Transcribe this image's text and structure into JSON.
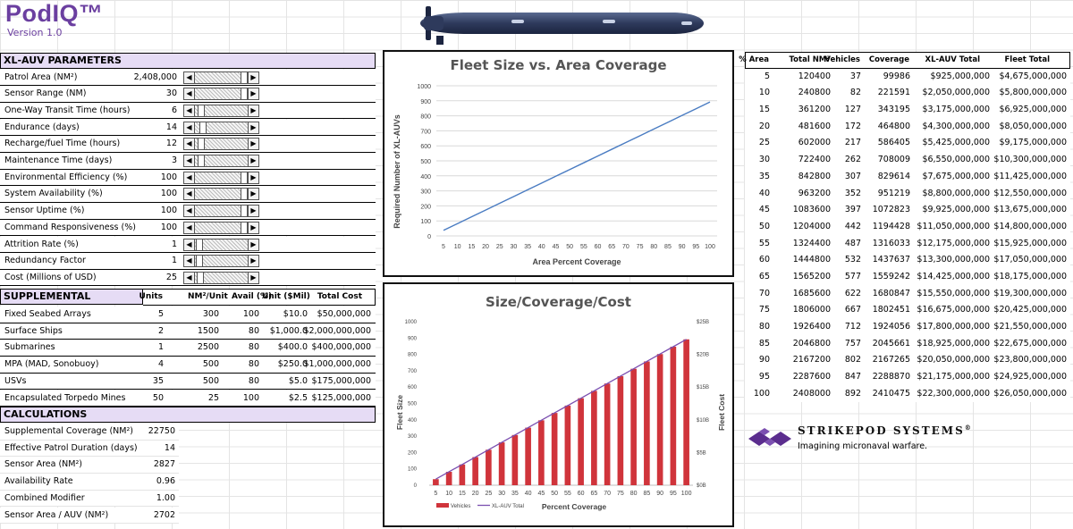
{
  "app": {
    "title": "PodIQ™",
    "version": "Version 1.0"
  },
  "params": {
    "header": "XL-AUV PARAMETERS",
    "rows": [
      {
        "label": "Patrol Area (NM²)",
        "value": "2,408,000",
        "level": 0.97
      },
      {
        "label": "Sensor Range (NM)",
        "value": "30",
        "level": 0.97
      },
      {
        "label": "One-Way Transit Time (hours)",
        "value": "6",
        "level": 0.05
      },
      {
        "label": "Endurance (days)",
        "value": "14",
        "level": 0.1
      },
      {
        "label": "Recharge/fuel Time (hours)",
        "value": "12",
        "level": 0.05
      },
      {
        "label": "Maintenance Time (days)",
        "value": "3",
        "level": 0.05
      },
      {
        "label": "Environmental Efficiency (%)",
        "value": "100",
        "level": 0.97
      },
      {
        "label": "System Availability (%)",
        "value": "100",
        "level": 0.97
      },
      {
        "label": "Sensor Uptime (%)",
        "value": "100",
        "level": 0.97
      },
      {
        "label": "Command Responsiveness (%)",
        "value": "100",
        "level": 0.97
      },
      {
        "label": "Attrition Rate (%)",
        "value": "1",
        "level": 0.02
      },
      {
        "label": "Redundancy Factor",
        "value": "1",
        "level": 0.02
      },
      {
        "label": "Cost (Millions of USD)",
        "value": "25",
        "level": 0.03
      }
    ]
  },
  "supplemental": {
    "header": "SUPPLEMENTAL",
    "columns": [
      "Units",
      "NM²/Unit",
      "Avail (%)",
      "Unit ($Mil)",
      "Total Cost"
    ],
    "rows": [
      {
        "name": "Fixed Seabed Arrays",
        "units": "5",
        "nm": "300",
        "avail": "100",
        "cost": "$10.0",
        "total": "$50,000,000"
      },
      {
        "name": "Surface Ships",
        "units": "2",
        "nm": "1500",
        "avail": "80",
        "cost": "$1,000.0",
        "total": "$2,000,000,000"
      },
      {
        "name": "Submarines",
        "units": "1",
        "nm": "2500",
        "avail": "80",
        "cost": "$400.0",
        "total": "$400,000,000"
      },
      {
        "name": "MPA (MAD, Sonobuoy)",
        "units": "4",
        "nm": "500",
        "avail": "80",
        "cost": "$250.0",
        "total": "$1,000,000,000"
      },
      {
        "name": "USVs",
        "units": "35",
        "nm": "500",
        "avail": "80",
        "cost": "$5.0",
        "total": "$175,000,000"
      },
      {
        "name": "Encapsulated Torpedo Mines",
        "units": "50",
        "nm": "25",
        "avail": "100",
        "cost": "$2.5",
        "total": "$125,000,000"
      }
    ]
  },
  "calculations": {
    "header": "CALCULATIONS",
    "rows": [
      {
        "label": "Supplemental Coverage (NM²)",
        "value": "22750"
      },
      {
        "label": "Effective Patrol Duration (days)",
        "value": "14"
      },
      {
        "label": "Sensor Area (NM²)",
        "value": "2827"
      },
      {
        "label": "Availability Rate",
        "value": "0.96"
      },
      {
        "label": "Combined Modifier",
        "value": "1.00"
      },
      {
        "label": "Sensor Area / AUV (NM²)",
        "value": "2702"
      }
    ]
  },
  "table": {
    "headers": [
      "% Area",
      "Total NM²",
      "Vehicles",
      "Coverage",
      "XL-AUV Total",
      "Fleet Total"
    ],
    "rows": [
      [
        "5",
        "120400",
        "37",
        "99986",
        "$925,000,000",
        "$4,675,000,000"
      ],
      [
        "10",
        "240800",
        "82",
        "221591",
        "$2,050,000,000",
        "$5,800,000,000"
      ],
      [
        "15",
        "361200",
        "127",
        "343195",
        "$3,175,000,000",
        "$6,925,000,000"
      ],
      [
        "20",
        "481600",
        "172",
        "464800",
        "$4,300,000,000",
        "$8,050,000,000"
      ],
      [
        "25",
        "602000",
        "217",
        "586405",
        "$5,425,000,000",
        "$9,175,000,000"
      ],
      [
        "30",
        "722400",
        "262",
        "708009",
        "$6,550,000,000",
        "$10,300,000,000"
      ],
      [
        "35",
        "842800",
        "307",
        "829614",
        "$7,675,000,000",
        "$11,425,000,000"
      ],
      [
        "40",
        "963200",
        "352",
        "951219",
        "$8,800,000,000",
        "$12,550,000,000"
      ],
      [
        "45",
        "1083600",
        "397",
        "1072823",
        "$9,925,000,000",
        "$13,675,000,000"
      ],
      [
        "50",
        "1204000",
        "442",
        "1194428",
        "$11,050,000,000",
        "$14,800,000,000"
      ],
      [
        "55",
        "1324400",
        "487",
        "1316033",
        "$12,175,000,000",
        "$15,925,000,000"
      ],
      [
        "60",
        "1444800",
        "532",
        "1437637",
        "$13,300,000,000",
        "$17,050,000,000"
      ],
      [
        "65",
        "1565200",
        "577",
        "1559242",
        "$14,425,000,000",
        "$18,175,000,000"
      ],
      [
        "70",
        "1685600",
        "622",
        "1680847",
        "$15,550,000,000",
        "$19,300,000,000"
      ],
      [
        "75",
        "1806000",
        "667",
        "1802451",
        "$16,675,000,000",
        "$20,425,000,000"
      ],
      [
        "80",
        "1926400",
        "712",
        "1924056",
        "$17,800,000,000",
        "$21,550,000,000"
      ],
      [
        "85",
        "2046800",
        "757",
        "2045661",
        "$18,925,000,000",
        "$22,675,000,000"
      ],
      [
        "90",
        "2167200",
        "802",
        "2167265",
        "$20,050,000,000",
        "$23,800,000,000"
      ],
      [
        "95",
        "2287600",
        "847",
        "2288870",
        "$21,175,000,000",
        "$24,925,000,000"
      ],
      [
        "100",
        "2408000",
        "892",
        "2410475",
        "$22,300,000,000",
        "$26,050,000,000"
      ]
    ]
  },
  "logo": {
    "name": "STRIKEPOD SYSTEMS",
    "mark": "®",
    "tagline": "Imagining micronaval warfare.",
    "color": "#5b2d8e"
  },
  "colors": {
    "accent": "#6b3fa0",
    "header_bg": "#e6dcf5",
    "line": "#4a7cc2",
    "bar": "#d0343b",
    "xl_line": "#7b4fb0",
    "sub": "#2e3a5c"
  },
  "chart_data": [
    {
      "type": "line",
      "title": "Fleet Size vs. Area Coverage",
      "xlabel": "Area Percent Coverage",
      "ylabel": "Required Number of XL-AUVs",
      "x": [
        5,
        10,
        15,
        20,
        25,
        30,
        35,
        40,
        45,
        50,
        55,
        60,
        65,
        70,
        75,
        80,
        85,
        90,
        95,
        100
      ],
      "values": [
        37,
        82,
        127,
        172,
        217,
        262,
        307,
        352,
        397,
        442,
        487,
        532,
        577,
        622,
        667,
        712,
        757,
        802,
        847,
        892
      ],
      "ylim": [
        0,
        1000
      ],
      "yticks": [
        0,
        100,
        200,
        300,
        400,
        500,
        600,
        700,
        800,
        900,
        1000
      ],
      "grid": true
    },
    {
      "type": "bar",
      "title": "Size/Coverage/Cost",
      "xlabel": "Percent Coverage",
      "ylabel": "Fleet Size",
      "y2label": "Fleet Cost",
      "x": [
        5,
        10,
        15,
        20,
        25,
        30,
        35,
        40,
        45,
        50,
        55,
        60,
        65,
        70,
        75,
        80,
        85,
        90,
        95,
        100
      ],
      "series": [
        {
          "name": "Vehicles",
          "values": [
            37,
            82,
            127,
            172,
            217,
            262,
            307,
            352,
            397,
            442,
            487,
            532,
            577,
            622,
            667,
            712,
            757,
            802,
            847,
            892
          ]
        },
        {
          "name": "XL-AUV Total",
          "axis": "right",
          "values": [
            0.925,
            2.05,
            3.175,
            4.3,
            5.425,
            6.55,
            7.675,
            8.8,
            9.925,
            11.05,
            12.175,
            13.3,
            14.425,
            15.55,
            16.675,
            17.8,
            18.925,
            20.05,
            21.175,
            22.3
          ]
        }
      ],
      "ylim": [
        0,
        1000
      ],
      "yticks": [
        0,
        100,
        200,
        300,
        400,
        500,
        600,
        700,
        800,
        900,
        1000
      ],
      "y2ticks": [
        "$0B",
        "$5B",
        "$10B",
        "$15B",
        "$20B",
        "$25B"
      ],
      "y2lim": [
        0,
        25
      ],
      "legend": "bottom-left"
    }
  ]
}
